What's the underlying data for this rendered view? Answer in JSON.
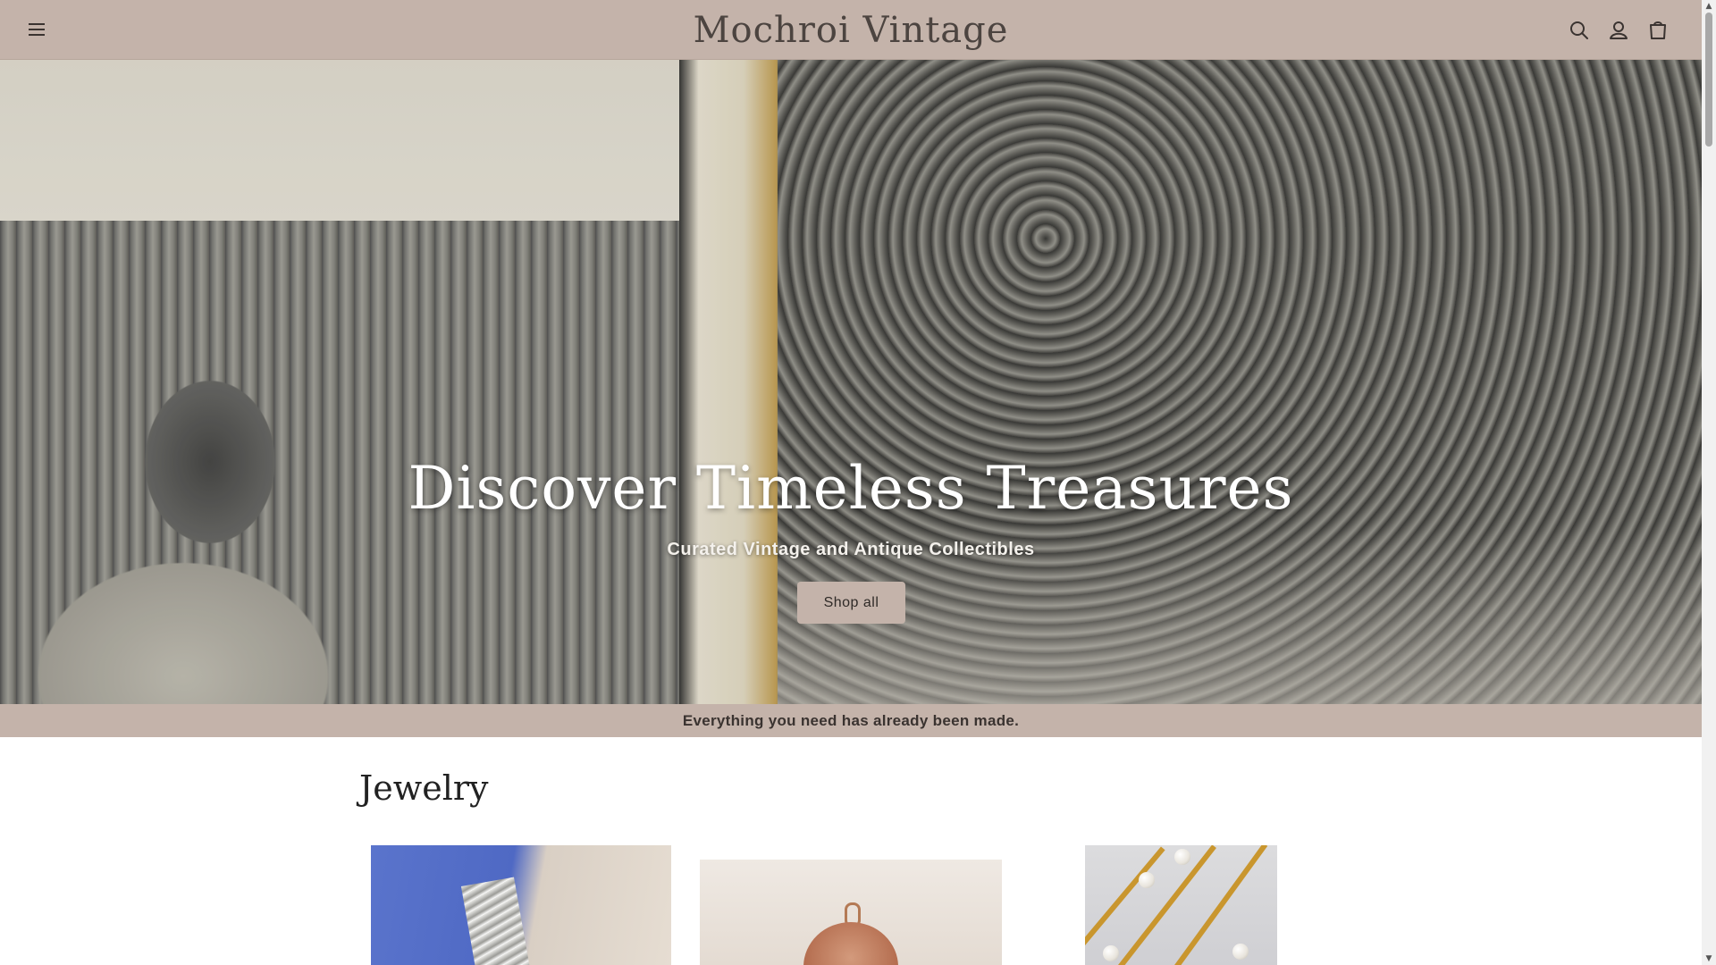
{
  "header": {
    "logo": "Mochroi Vintage",
    "menu_icon": "hamburger-menu-icon",
    "search_icon": "search-icon",
    "account_icon": "account-icon",
    "cart_icon": "cart-icon",
    "background": "#c4b3aa"
  },
  "hero": {
    "title": "Discover Timeless Treasures",
    "subtitle": "Curated Vintage and Antique Collectibles",
    "button_label": "Shop all"
  },
  "announcement": {
    "text": "Everything you need has already been made."
  },
  "collection": {
    "title": "Jewelry",
    "items": [
      {
        "image": "bracelet-photo"
      },
      {
        "image": "locket-photo"
      },
      {
        "image": "pearl-chain-photo"
      }
    ]
  },
  "colors": {
    "accent": "#c4b3aa",
    "text_dark": "#3a3330"
  }
}
